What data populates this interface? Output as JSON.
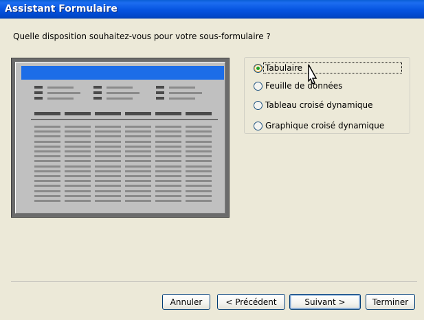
{
  "window": {
    "title": "Assistant Formulaire"
  },
  "prompt": "Quelle disposition souhaitez-vous pour votre sous-formulaire ?",
  "layout_options": [
    {
      "label": "Tabulaire",
      "checked": true
    },
    {
      "label": "Feuille de données",
      "checked": false
    },
    {
      "label": "Tableau croisé dynamique",
      "checked": false
    },
    {
      "label": "Graphique croisé dynamique",
      "checked": false
    }
  ],
  "buttons": {
    "cancel": "Annuler",
    "back": "< Précédent",
    "next": "Suivant >",
    "finish": "Terminer"
  },
  "colors": {
    "title_bar": "#0553e0",
    "dialog_bg": "#ece9d8",
    "preview_header": "#1c6de8",
    "radio_selected": "#21a121"
  },
  "icons": [
    "mouse-pointer-icon"
  ]
}
